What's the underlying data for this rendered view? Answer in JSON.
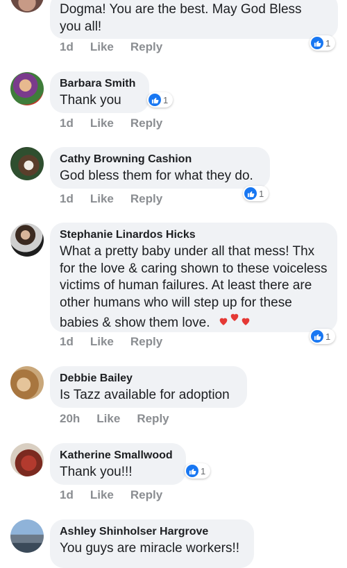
{
  "comments": [
    {
      "name": "",
      "text": "Dogma!  You are the best.  May God Bless you all!",
      "time": "1d",
      "reaction_count": "1"
    },
    {
      "name": "Barbara Smith",
      "text": "Thank you",
      "time": "1d",
      "reaction_count": "1"
    },
    {
      "name": "Cathy Browning Cashion",
      "text": "God bless them for what they do.",
      "time": "1d",
      "reaction_count": "1"
    },
    {
      "name": "Stephanie Linardos Hicks",
      "text": "What a pretty baby under all that mess!  Thx for the love & caring shown to these voiceless victims of human failures.   At least there are other humans who will step up for these babies & show them love.",
      "time": "1d",
      "reaction_count": "1"
    },
    {
      "name": "Debbie Bailey",
      "text": "Is Tazz available for adoption",
      "time": "20h"
    },
    {
      "name": "Katherine Smallwood",
      "text": "Thank you!!!",
      "time": "1d",
      "reaction_count": "1"
    },
    {
      "name": "Ashley Shinholser Hargrove",
      "text": "You guys are miracle workers!!"
    }
  ],
  "actions": {
    "like": "Like",
    "reply": "Reply"
  },
  "colors": {
    "like_blue": "#1877f2",
    "bubble_bg": "#f0f2f5",
    "meta_grey": "#8a8d91",
    "heart_red": "#e53935"
  }
}
